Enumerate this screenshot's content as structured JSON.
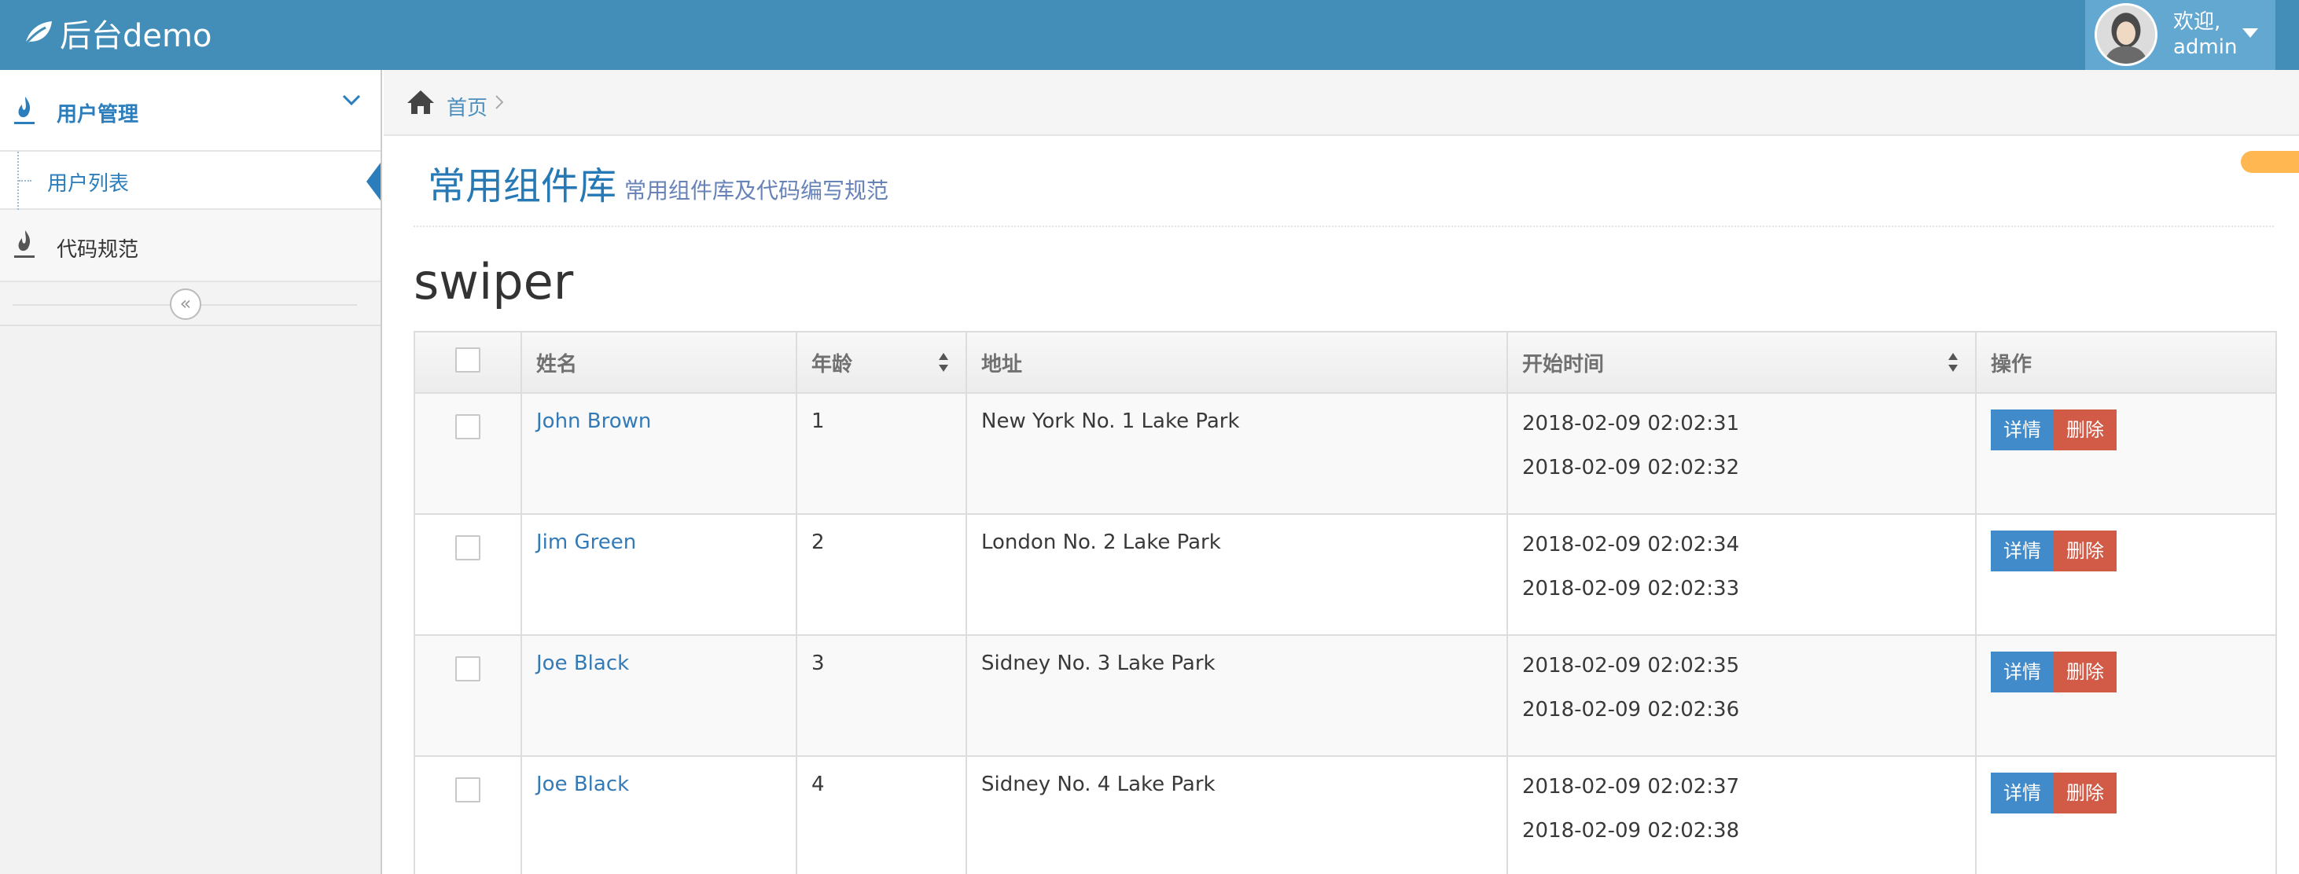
{
  "header": {
    "logo_text": "后台demo",
    "welcome": "欢迎,",
    "username": "admin"
  },
  "sidebar": {
    "items": [
      {
        "label": "用户管理",
        "expanded": true,
        "children": [
          {
            "label": "用户列表",
            "active": true
          }
        ]
      },
      {
        "label": "代码规范"
      }
    ],
    "collapse_icon": "double-chevron-left-icon"
  },
  "breadcrumb": {
    "home": "首页"
  },
  "page": {
    "title": "常用组件库",
    "subtitle": "常用组件库及代码编写规范",
    "section": "swiper"
  },
  "table": {
    "columns": [
      "",
      "姓名",
      "年龄",
      "地址",
      "开始时间",
      "操作"
    ],
    "sortable": [
      "年龄",
      "开始时间"
    ],
    "rows": [
      {
        "name": "John Brown",
        "age": "1",
        "address": "New York No. 1 Lake Park",
        "time1": "2018-02-09 02:02:31",
        "time2": "2018-02-09 02:02:32"
      },
      {
        "name": "Jim Green",
        "age": "2",
        "address": "London No. 2 Lake Park",
        "time1": "2018-02-09 02:02:34",
        "time2": "2018-02-09 02:02:33"
      },
      {
        "name": "Joe Black",
        "age": "3",
        "address": "Sidney No. 3 Lake Park",
        "time1": "2018-02-09 02:02:35",
        "time2": "2018-02-09 02:02:36"
      },
      {
        "name": "Joe Black",
        "age": "4",
        "address": "Sidney No. 4 Lake Park",
        "time1": "2018-02-09 02:02:37",
        "time2": "2018-02-09 02:02:38"
      }
    ],
    "actions": {
      "detail": "详情",
      "delete": "删除"
    }
  },
  "colors": {
    "topbar": "#438eb9",
    "user_area": "#62a8d1",
    "accent": "#2b7dbc",
    "btn_detail": "#428bca",
    "btn_delete": "#d15b47",
    "orange_tab": "#ffb752"
  }
}
